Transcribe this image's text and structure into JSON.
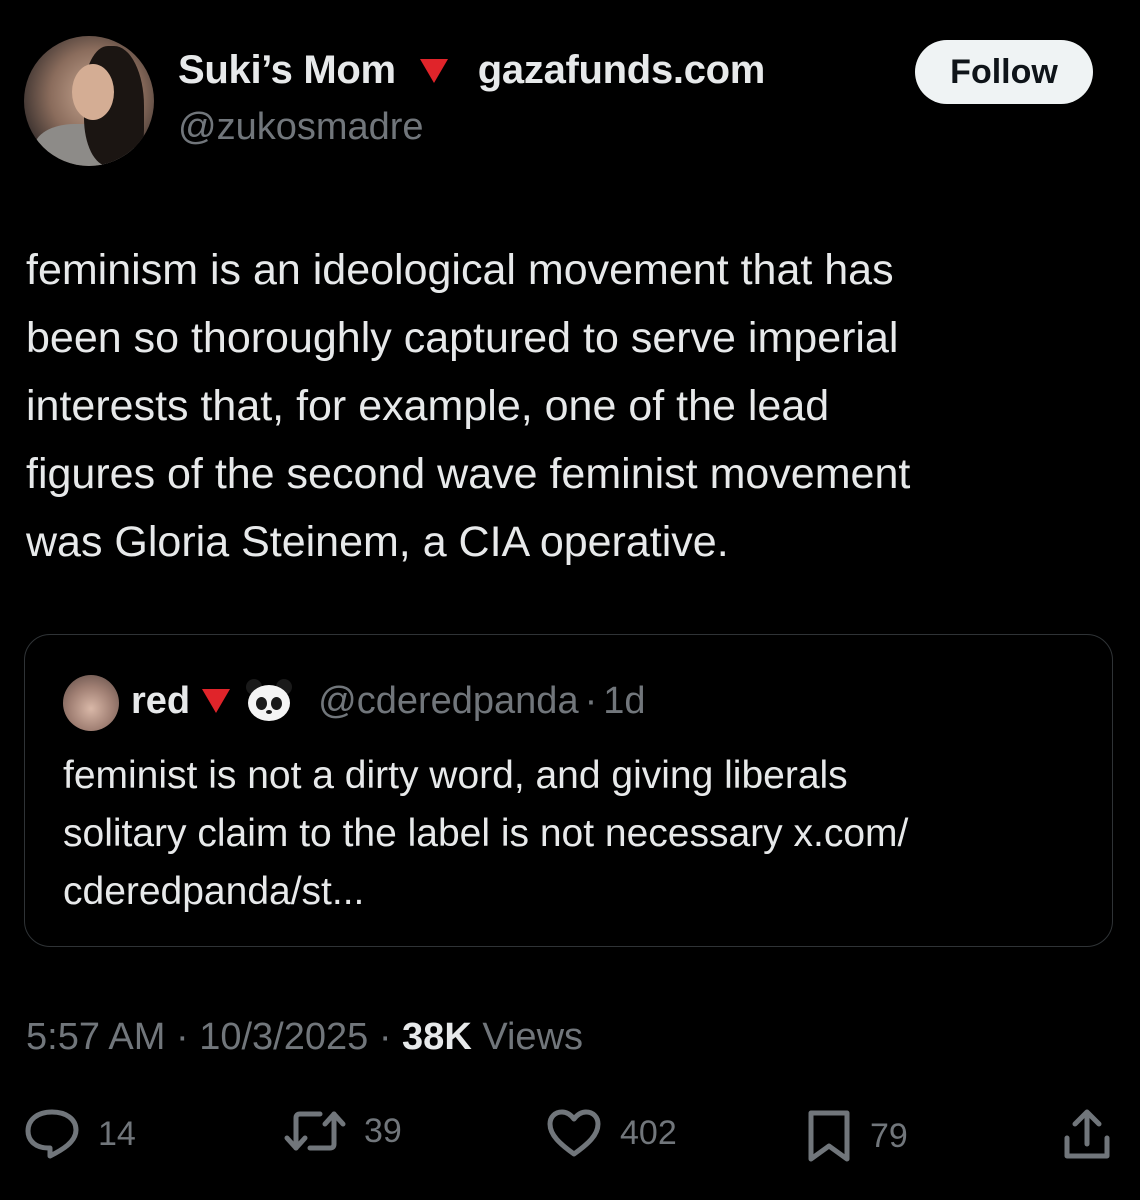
{
  "author": {
    "display_name": "Suki’s Mom",
    "name_link": "gazafunds.com",
    "handle": "@zukosmadre"
  },
  "follow_label": "Follow",
  "tweet_lines": [
    "feminism is an ideological movement that has",
    "been so thoroughly captured to serve imperial",
    "interests that, for example, one of the lead",
    "figures of the second wave feminist movement",
    "was Gloria Steinem, a CIA operative."
  ],
  "quote": {
    "name": "red",
    "handle": "@cderedpanda",
    "separator": "·",
    "age": "1d",
    "lines": [
      "feminist is not a dirty word, and giving liberals",
      "solitary claim to the label is not necessary x.com/",
      "cderedpanda/st..."
    ]
  },
  "meta": {
    "time": "5:57 AM",
    "date": "10/3/2025",
    "views_count": "38K",
    "views_label": "Views",
    "separator": "·"
  },
  "actions": {
    "replies": "14",
    "reposts": "39",
    "likes": "402",
    "bookmarks": "79"
  },
  "colors": {
    "background": "#000000",
    "text": "#e7e9ea",
    "secondary": "#71767b",
    "border": "#2f3336",
    "accent_red": "#e0242a"
  },
  "icons": [
    "red-triangle-icon",
    "panda-icon",
    "reply-icon",
    "repost-icon",
    "like-icon",
    "bookmark-icon",
    "share-icon"
  ]
}
